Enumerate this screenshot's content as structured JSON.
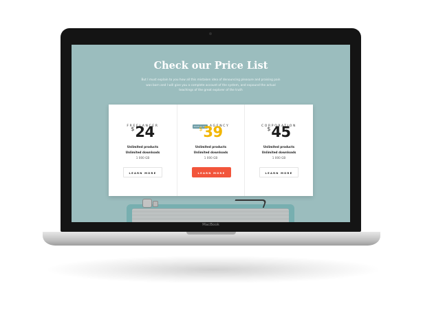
{
  "device": {
    "brand_label": "MacBook"
  },
  "page": {
    "title": "Check our Price List",
    "intro": "But I must explain to you how all this mistaken idea of denouncing pleasure and praising pain was born and I will give you a complete account of the system, and expound the actual teachings of the great explorer of the truth"
  },
  "plans": [
    {
      "name": "FREELANCER",
      "badge": "",
      "currency": "$",
      "price": "24",
      "features": [
        "Unlimited products",
        "Unlimited downloads",
        "1 000 GB"
      ],
      "button": "LEARN MORE",
      "highlighted": false
    },
    {
      "name": "AGENCY",
      "badge": "POPULAR",
      "currency": "$",
      "price": "39",
      "features": [
        "Unlimited products",
        "Unlimited downloads",
        "1 000 GB"
      ],
      "button": "LEARN MORE",
      "highlighted": true
    },
    {
      "name": "CORPORATION",
      "badge": "",
      "currency": "$",
      "price": "45",
      "features": [
        "Unlimited products",
        "Unlimited downloads",
        "1 000 GB"
      ],
      "button": "LEARN MORE",
      "highlighted": false
    }
  ],
  "colors": {
    "screen_background": "#9bbdbe",
    "price_highlight": "#f2b600",
    "button_highlight": "#f2553b",
    "badge": "#6e9da7"
  }
}
